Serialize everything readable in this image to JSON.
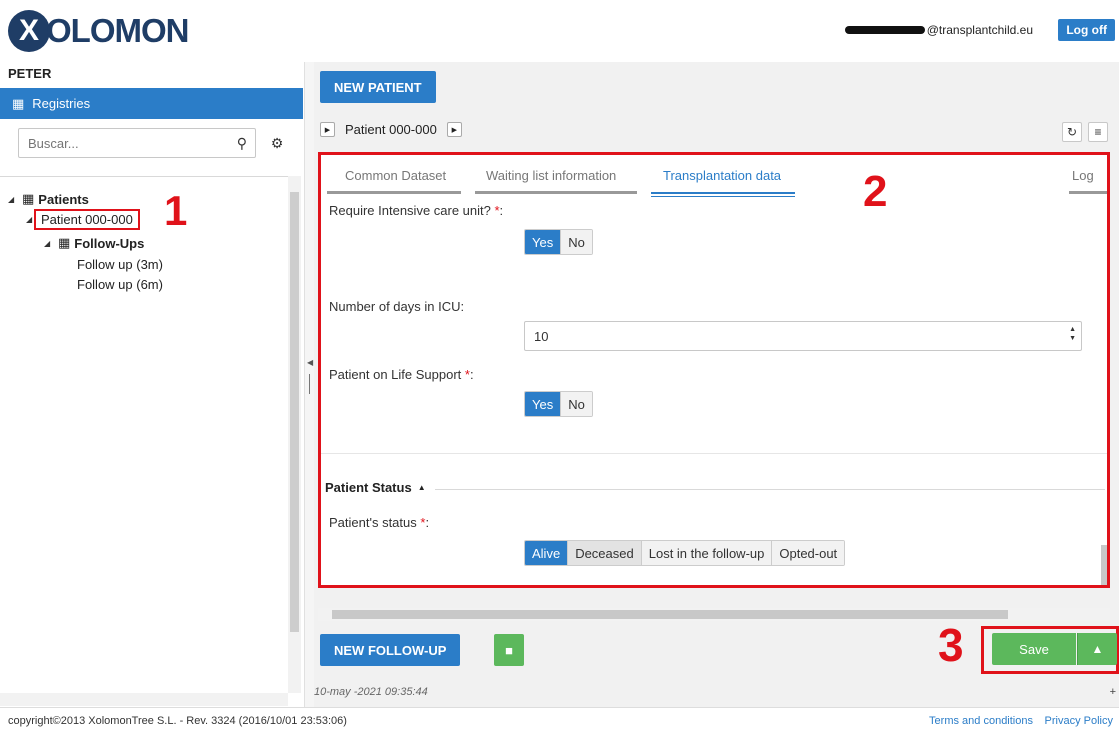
{
  "header": {
    "logo_mark": "X",
    "logo_text": "OLOMON",
    "user_email": "@transplantchild.eu",
    "logoff_label": "Log off"
  },
  "sidebar": {
    "user_name": "PETER",
    "registries_label": "Registries",
    "search_placeholder": "Buscar...",
    "tree": {
      "root": "Patients",
      "patient": "Patient 000-000",
      "followups_group": "Follow-Ups",
      "followups": [
        "Follow up (3m)",
        "Follow up (6m)"
      ]
    },
    "marker_1": "1"
  },
  "main": {
    "new_patient_label": "NEW PATIENT",
    "breadcrumb_patient": "Patient 000-000",
    "tabs": [
      {
        "label": "Common Dataset"
      },
      {
        "label": "Waiting list information"
      },
      {
        "label": "Transplantation data"
      },
      {
        "label": "Log"
      }
    ],
    "active_tab": "Transplantation data",
    "marker_2": "2",
    "fields": {
      "icu_label": "Require Intensive care unit? ",
      "icu_yes": "Yes",
      "icu_no": "No",
      "icu_days_label": "Number of days in ICU:",
      "icu_days_value": "10",
      "life_support_label": "Patient on Life Support ",
      "life_support_yes": "Yes",
      "life_support_no": "No",
      "required_mark": "*",
      "colon": ":"
    },
    "patient_status": {
      "section_title": "Patient Status",
      "status_label": "Patient's status ",
      "options": [
        "Alive",
        "Deceased",
        "Lost in the follow-up",
        "Opted-out"
      ],
      "selected": "Alive"
    },
    "new_followup_label": "NEW FOLLOW-UP",
    "save_label": "Save",
    "marker_3": "3",
    "timestamp": "10-may -2021 09:35:44"
  },
  "footer": {
    "copyright": "copyright©2013 XolomonTree S.L. - Rev. 3324 (2016/10/01 23:53:06)",
    "terms": "Terms and conditions",
    "privacy": "Privacy Policy"
  },
  "colors": {
    "accent": "#2b7dc8",
    "success": "#5cb85c",
    "highlight": "#e0121a",
    "brand": "#1f3d66"
  }
}
